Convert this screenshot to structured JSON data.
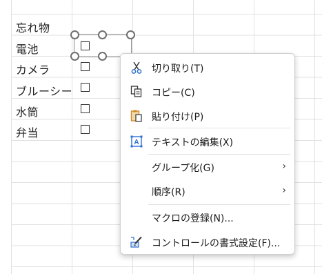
{
  "sheet": {
    "items": [
      "忘れ物",
      "電池",
      "カメラ",
      "ブルーシー",
      "水筒",
      "弁当"
    ]
  },
  "context_menu": {
    "items": [
      {
        "label": "切り取り(T)",
        "icon": "scissors-icon"
      },
      {
        "label": "コピー(C)",
        "icon": "copy-icon"
      },
      {
        "label": "貼り付け(P)",
        "icon": "paste-icon"
      },
      {
        "label": "テキストの編集(X)",
        "icon": "text-edit-icon"
      },
      {
        "label": "グループ化(G)",
        "submenu": true
      },
      {
        "label": "順序(R)",
        "submenu": true
      },
      {
        "label": "マクロの登録(N)..."
      },
      {
        "label": "コントロールの書式設定(F)...",
        "icon": "format-control-icon"
      }
    ],
    "submenu_arrow": "›"
  },
  "colors": {
    "grid": "#e1e1e1",
    "accent_blue": "#2f6fd1",
    "paste_orange": "#d08a2a"
  }
}
